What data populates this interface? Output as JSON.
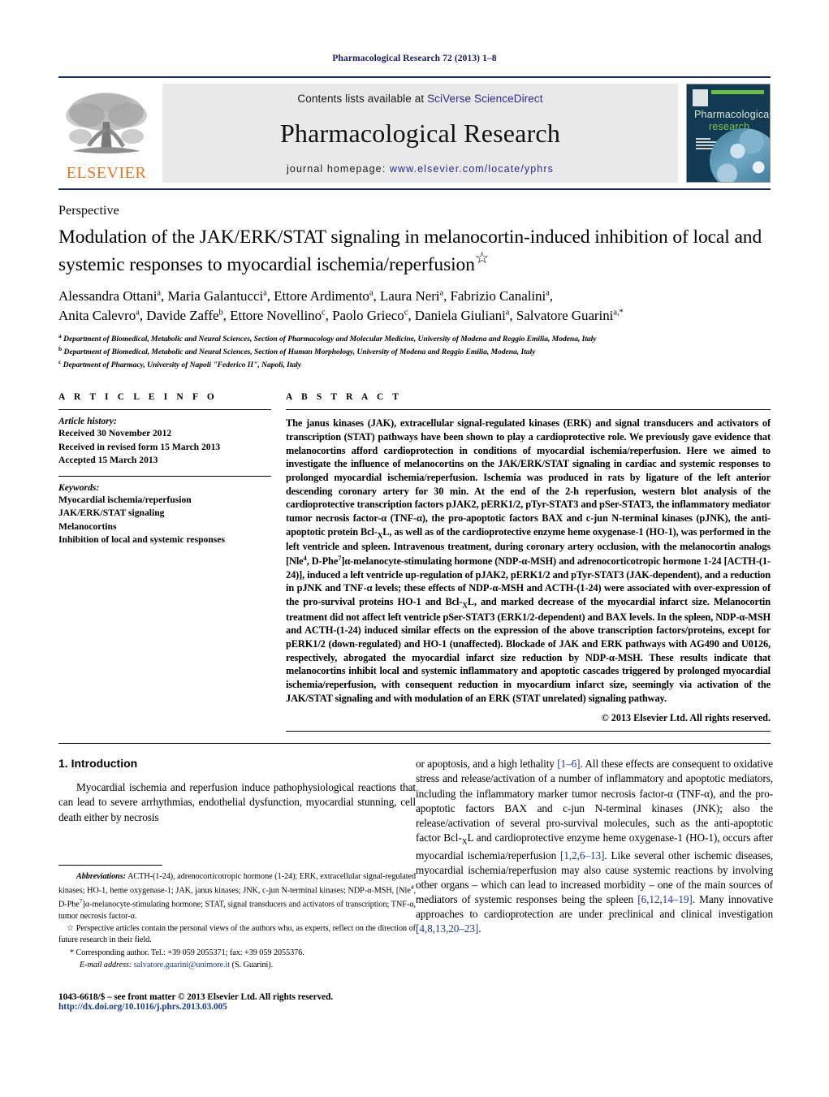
{
  "running_head": "Pharmacological Research 72 (2013) 1–8",
  "masthead": {
    "publisher_name": "ELSEVIER",
    "contents_prefix": "Contents lists available at ",
    "contents_link": "SciVerse ScienceDirect",
    "journal_title": "Pharmacological Research",
    "homepage_prefix": "journal homepage: ",
    "homepage_url": "www.elsevier.com/locate/yphrs",
    "cover": {
      "line1": "Pharmacological",
      "line2": "research"
    },
    "accent_orange": "#E87722",
    "link_blue": "#2b2b8f",
    "rule_navy": "#1d2a5b"
  },
  "article": {
    "type_label": "Perspective",
    "title": "Modulation of the JAK/ERK/STAT signaling in melanocortin-induced inhibition of local and systemic responses to myocardial ischemia/reperfusion",
    "title_marker": "☆",
    "authors_line1": "Alessandra Ottani",
    "authors": [
      {
        "name": "Alessandra Ottani",
        "sup": "a"
      },
      {
        "name": "Maria Galantucci",
        "sup": "a"
      },
      {
        "name": "Ettore Ardimento",
        "sup": "a"
      },
      {
        "name": "Laura Neri",
        "sup": "a"
      },
      {
        "name": "Fabrizio Canalini",
        "sup": "a"
      },
      {
        "name": "Anita Calevro",
        "sup": "a"
      },
      {
        "name": "Davide Zaffe",
        "sup": "b"
      },
      {
        "name": "Ettore Novellino",
        "sup": "c"
      },
      {
        "name": "Paolo Grieco",
        "sup": "c"
      },
      {
        "name": "Daniela Giuliani",
        "sup": "a"
      },
      {
        "name": "Salvatore Guarini",
        "sup": "a,*"
      }
    ],
    "affiliations": [
      {
        "marker": "a",
        "text": "Department of Biomedical, Metabolic and Neural Sciences, Section of Pharmacology and Molecular Medicine, University of Modena and Reggio Emilia, Modena, Italy"
      },
      {
        "marker": "b",
        "text": "Department of Biomedical, Metabolic and Neural Sciences, Section of Human Morphology, University of Modena and Reggio Emilia, Modena, Italy"
      },
      {
        "marker": "c",
        "text": "Department of Pharmacy, University of Napoli \"Federico II\", Napoli, Italy"
      }
    ]
  },
  "article_info": {
    "heading": "A R T I C L E    I N F O",
    "history_label": "Article history:",
    "history": [
      "Received 30 November 2012",
      "Received in revised form 15 March 2013",
      "Accepted 15 March 2013"
    ],
    "keywords_label": "Keywords:",
    "keywords": [
      "Myocardial ischemia/reperfusion",
      "JAK/ERK/STAT signaling",
      "Melanocortins",
      "Inhibition of local and systemic responses"
    ]
  },
  "abstract": {
    "heading": "A B S T R A C T",
    "part1": "The janus kinases (JAK), extracellular signal-regulated kinases (ERK) and signal transducers and activators of transcription (STAT) pathways have been shown to play a cardioprotective role. We previously gave evidence that melanocortins afford cardioprotection in conditions of myocardial ischemia/reperfusion. Here we aimed to investigate the influence of melanocortins on the JAK/ERK/STAT signaling in cardiac and systemic responses to prolonged myocardial ischemia/reperfusion. Ischemia was produced in rats by ligature of the left anterior descending coronary artery for 30 min. At the end of the 2-h reperfusion, western blot analysis of the cardioprotective transcription factors pJAK2, pERK1/2, pTyr-STAT3 and pSer-STAT3, the inflammatory mediator tumor necrosis factor-α (TNF-α), the pro-apoptotic factors BAX and c-jun N-terminal kinases (pJNK), the anti-apoptotic protein Bcl-",
    "sub1": "X",
    "part2": "L, as well as of the cardioprotective enzyme heme oxygenase-1 (HO-1), was performed in the left ventricle and spleen. Intravenous treatment, during coronary artery occlusion, with the melanocortin analogs [Nle",
    "sup1": "4",
    "part3": ", D-Phe",
    "sup2": "7",
    "part4": "]α-melanocyte-stimulating hormone (NDP-α-MSH) and adrenocorticotropic hormone 1-24 [ACTH-(1-24)], induced a left ventricle up-regulation of pJAK2, pERK1/2 and pTyr-STAT3 (JAK-dependent), and a reduction in pJNK and TNF-α levels; these effects of NDP-α-MSH and ACTH-(1-24) were associated with over-expression of the pro-survival proteins HO-1 and Bcl-",
    "sub2": "X",
    "part5": "L, and marked decrease of the myocardial infarct size. Melanocortin treatment did not affect left ventricle pSer-STAT3 (ERK1/2-dependent) and BAX levels. In the spleen, NDP-α-MSH and ACTH-(1-24) induced similar effects on the expression of the above transcription factors/proteins, except for pERK1/2 (down-regulated) and HO-1 (unaffected). Blockade of JAK and ERK pathways with AG490 and U0126, respectively, abrogated the myocardial infarct size reduction by NDP-α-MSH. These results indicate that melanocortins inhibit local and systemic inflammatory and apoptotic cascades triggered by prolonged myocardial ischemia/reperfusion, with consequent reduction in myocardium infarct size, seemingly via activation of the JAK/STAT signaling and with modulation of an ERK (STAT unrelated) signaling pathway.",
    "copyright": "© 2013 Elsevier Ltd. All rights reserved."
  },
  "introduction": {
    "section_number_title": "1.  Introduction",
    "left_para_part1": "Myocardial ischemia and reperfusion induce pathophysiological reactions that can lead to severe arrhythmias, endothelial dysfunction, myocardial stunning, cell death either by necrosis",
    "right_part1": "or apoptosis, and a high lethality ",
    "right_ref1": "[1–6]",
    "right_part2": ". All these effects are consequent to oxidative stress and release/activation of a number of inflammatory and apoptotic mediators, including the inflammatory marker tumor necrosis factor-α (TNF-α), and the pro-apoptotic factors BAX and c-jun N-terminal kinases (JNK); also the release/activation of several pro-survival molecules, such as the anti-apoptotic factor Bcl-",
    "right_sub1": "X",
    "right_part3": "L and cardioprotective enzyme heme oxygenase-1 (HO-1), occurs after myocardial ischemia/reperfusion ",
    "right_ref2": "[1,2,6–13]",
    "right_part4": ". Like several other ischemic diseases, myocardial ischemia/reperfusion may also cause systemic reactions by involving other organs – which can lead to increased morbidity – one of the main sources of mediators of systemic responses being the spleen ",
    "right_ref3": "[6,12,14–19]",
    "right_part5": ". Many innovative approaches to cardioprotection are under preclinical and clinical investigation ",
    "right_ref4": "[4,8,13,20–23]",
    "right_part6": "."
  },
  "footnotes": {
    "abbrev_label": "Abbreviations:",
    "abbrev_text": " ACTH-(1-24), adrenocorticotropic hormone (1-24); ERK, extracellular signal-regulated kinases; HO-1, heme oxygenase-1; JAK, janus kinases; JNK, c-jun N-terminal kinases; NDP-α-MSH, [Nle",
    "abbrev_sup1": "4",
    "abbrev_text2": ", D-Phe",
    "abbrev_sup2": "7",
    "abbrev_text3": "]α-melanocyte-stimulating hormone; STAT, signal transducers and activators of transcription; TNF-α, tumor necrosis factor-α.",
    "star_marker": "☆",
    "star_text": " Perspective articles contain the personal views of the authors who, as experts, reflect on the direction of future research in their field.",
    "corr_marker": "*",
    "corr_text": " Corresponding author. Tel.: +39 059 2055371; fax: +39 059 2055376.",
    "email_label": "E-mail address:",
    "email_value": "salvatore.guarini@unimore.it",
    "email_suffix": " (S. Guarini)."
  },
  "page_footer": {
    "issn_line": "1043-6618/$ – see front matter © 2013 Elsevier Ltd. All rights reserved.",
    "doi_line": "http://dx.doi.org/10.1016/j.phrs.2013.03.005"
  }
}
